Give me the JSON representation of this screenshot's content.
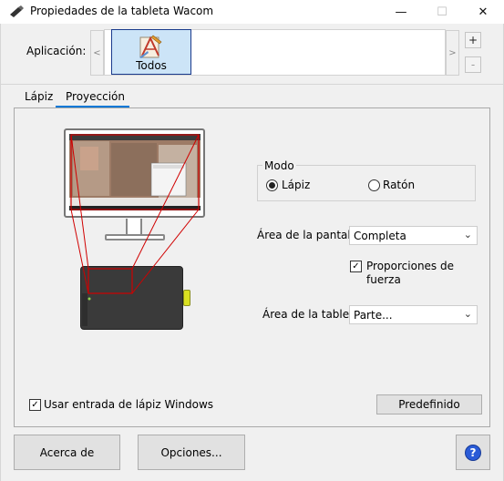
{
  "window": {
    "title": "Propiedades de la tableta Wacom",
    "icon": "tablet-pen-icon",
    "controls": {
      "minimize": "—",
      "maximize": "☐",
      "close": "✕"
    }
  },
  "application": {
    "label": "Aplicación:",
    "prev_arrow": "<",
    "next_arrow": ">",
    "selected_item": "Todos",
    "add": "+",
    "remove": "-"
  },
  "tabs": [
    {
      "label": "Lápiz",
      "active": false
    },
    {
      "label": "Proyección",
      "active": true
    }
  ],
  "projection": {
    "mode": {
      "title": "Modo",
      "options": [
        {
          "label": "Lápiz",
          "selected": true
        },
        {
          "label": "Ratón",
          "selected": false
        }
      ]
    },
    "screen_area": {
      "label": "Área de la pantalla:",
      "value": "Completa"
    },
    "force_proportions": {
      "label": "Proporciones de fuerza",
      "checked": true
    },
    "tablet_area": {
      "label": "Área de la tableta:",
      "value": "Parte..."
    },
    "windows_ink": {
      "label": "Usar entrada de lápiz Windows",
      "checked": true
    },
    "default_button": "Predefinido"
  },
  "footer": {
    "about_button": "Acerca de",
    "options_button": "Opciones...",
    "help_button": "?"
  },
  "colors": {
    "accent": "#0078d7",
    "selection_fill": "#cce4f7",
    "mapping_lines": "#d00000",
    "tablet_body": "#3a3a3a",
    "tablet_button": "#d9e021"
  }
}
